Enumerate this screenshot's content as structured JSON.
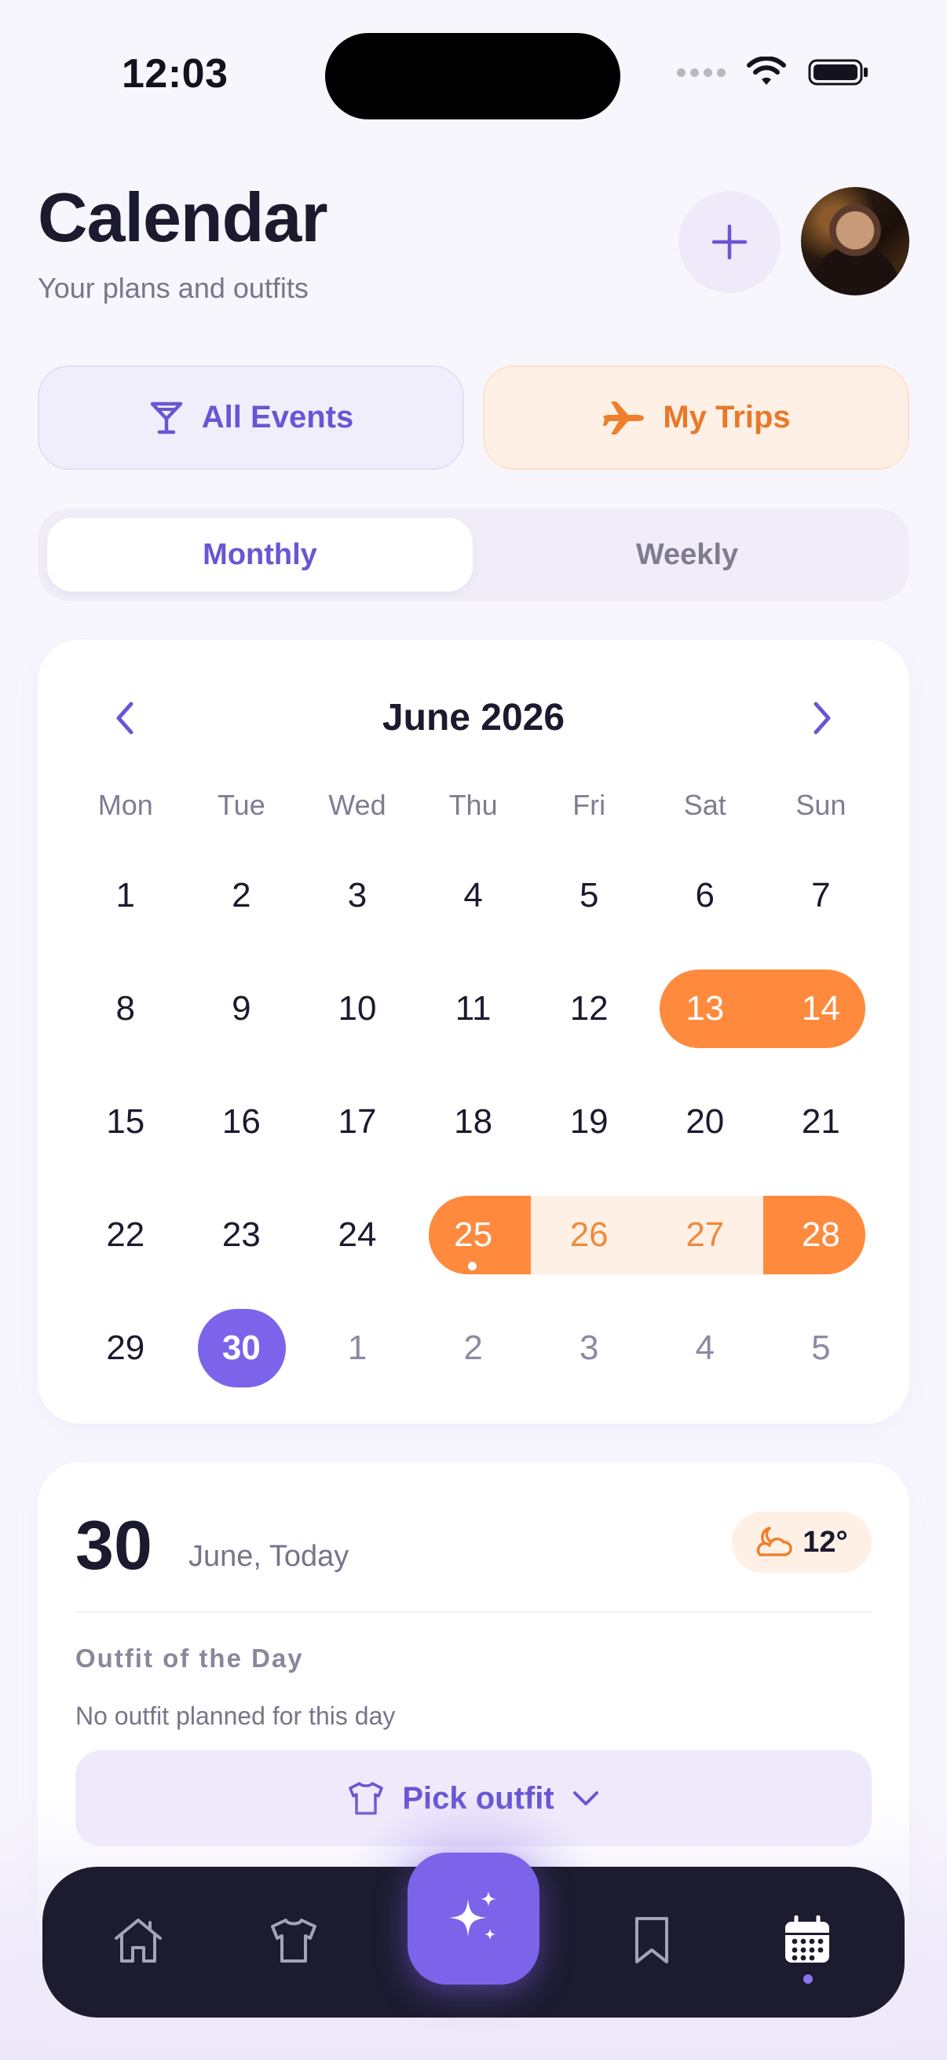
{
  "status_bar": {
    "time": "12:03"
  },
  "header": {
    "title": "Calendar",
    "subtitle": "Your plans and outfits"
  },
  "filters": {
    "events_label": "All Events",
    "trips_label": "My Trips"
  },
  "view_toggle": {
    "monthly": "Monthly",
    "weekly": "Weekly",
    "selected": "Monthly"
  },
  "calendar": {
    "month_label": "June 2026",
    "weekdays": [
      "Mon",
      "Tue",
      "Wed",
      "Thu",
      "Fri",
      "Sat",
      "Sun"
    ],
    "weeks": [
      [
        "1",
        "2",
        "3",
        "4",
        "5",
        "6",
        "7"
      ],
      [
        "8",
        "9",
        "10",
        "11",
        "12",
        "13",
        "14"
      ],
      [
        "15",
        "16",
        "17",
        "18",
        "19",
        "20",
        "21"
      ],
      [
        "22",
        "23",
        "24",
        "25",
        "26",
        "27",
        "28"
      ],
      [
        "29",
        "30",
        "1",
        "2",
        "3",
        "4",
        "5"
      ]
    ],
    "selected_day": "30",
    "trip_ranges": [
      [
        "13",
        "14"
      ],
      [
        "25",
        "28"
      ]
    ]
  },
  "today": {
    "day_number": "30",
    "date_label": "June, Today",
    "temperature": "12°",
    "weather_icon": "moon-cloud-icon",
    "outfit_section_title": "Outfit of the Day",
    "outfit_empty_text": "No outfit planned for this day",
    "pick_outfit_label": "Pick outfit"
  },
  "tabbar": {
    "items": [
      "home-icon",
      "shirt-icon",
      "sparkles-icon",
      "bookmark-icon",
      "calendar-icon"
    ],
    "active": "calendar-icon"
  },
  "colors": {
    "accent": "#6a55d4",
    "accent_fab": "#7b63ea",
    "trip_orange": "#ff8a3d",
    "trip_orange_light": "#fff0e5",
    "tabbar_bg": "#1d1b2f"
  }
}
